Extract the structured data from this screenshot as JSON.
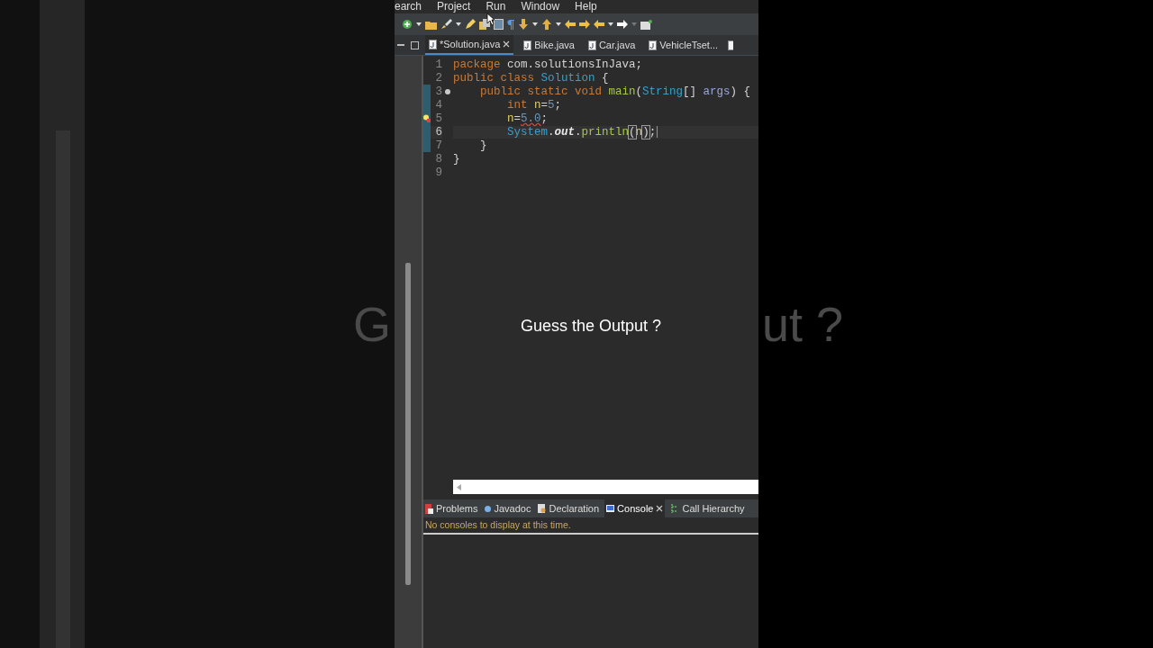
{
  "backdrop": {
    "left_text": "G",
    "right_text": "ut ?"
  },
  "menu": [
    "earch",
    "Project",
    "Run",
    "Window",
    "Help"
  ],
  "editor_tabs": [
    {
      "label": "*Solution.java",
      "selected": true,
      "closable": true
    },
    {
      "label": "Bike.java",
      "selected": false,
      "closable": false
    },
    {
      "label": "Car.java",
      "selected": false,
      "closable": false
    },
    {
      "label": "VehicleTset...",
      "selected": false,
      "closable": false
    }
  ],
  "code_lines": [
    {
      "number": "1",
      "range": false,
      "override": false,
      "error": false,
      "current": false,
      "tokens": [
        {
          "kind": "keyword",
          "text": "package"
        },
        {
          "kind": "plain",
          "text": " com.solutionsInJava;"
        }
      ]
    },
    {
      "number": "2",
      "range": false,
      "override": false,
      "error": false,
      "current": false,
      "tokens": [
        {
          "kind": "keyword",
          "text": "public class "
        },
        {
          "kind": "type",
          "text": "Solution"
        },
        {
          "kind": "plain",
          "text": " {"
        }
      ]
    },
    {
      "number": "3",
      "range": true,
      "override": true,
      "error": false,
      "current": false,
      "tokens": [
        {
          "kind": "keyword",
          "text": "    public static void "
        },
        {
          "kind": "method",
          "text": "main"
        },
        {
          "kind": "plain",
          "text": "("
        },
        {
          "kind": "type",
          "text": "String"
        },
        {
          "kind": "plain",
          "text": "[] "
        },
        {
          "kind": "param",
          "text": "args"
        },
        {
          "kind": "plain",
          "text": ") {"
        }
      ]
    },
    {
      "number": "4",
      "range": true,
      "override": false,
      "error": false,
      "current": false,
      "tokens": [
        {
          "kind": "keyword",
          "text": "        int "
        },
        {
          "kind": "variable",
          "text": "n"
        },
        {
          "kind": "plain",
          "text": "="
        },
        {
          "kind": "number",
          "text": "5"
        },
        {
          "kind": "plain",
          "text": ";"
        }
      ]
    },
    {
      "number": "5",
      "range": true,
      "override": false,
      "error": true,
      "current": false,
      "tokens": [
        {
          "kind": "variable",
          "text": "        n"
        },
        {
          "kind": "plain",
          "text": "="
        },
        {
          "kind": "number_error",
          "text": "5.0"
        },
        {
          "kind": "plain",
          "text": ";"
        }
      ]
    },
    {
      "number": "6",
      "range": true,
      "override": false,
      "error": false,
      "current": true,
      "tokens": [
        {
          "kind": "type",
          "text": "        System"
        },
        {
          "kind": "plain",
          "text": "."
        },
        {
          "kind": "field",
          "text": "out"
        },
        {
          "kind": "plain",
          "text": "."
        },
        {
          "kind": "method",
          "text": "println"
        },
        {
          "kind": "bracket",
          "text": "("
        },
        {
          "kind": "variable",
          "text": "n"
        },
        {
          "kind": "bracket",
          "text": ")"
        },
        {
          "kind": "plain",
          "text": ";"
        }
      ]
    },
    {
      "number": "7",
      "range": true,
      "override": false,
      "error": false,
      "current": false,
      "tokens": [
        {
          "kind": "plain",
          "text": "    }"
        }
      ]
    },
    {
      "number": "8",
      "range": false,
      "override": false,
      "error": false,
      "current": false,
      "tokens": [
        {
          "kind": "plain",
          "text": "}"
        }
      ]
    },
    {
      "number": "9",
      "range": false,
      "override": false,
      "error": false,
      "current": false
    }
  ],
  "overlay_caption": "Guess the Output ?",
  "bottom_tabs": [
    {
      "label": "Problems",
      "selected": false,
      "closable": false
    },
    {
      "label": "Javadoc",
      "selected": false,
      "closable": false
    },
    {
      "label": "Declaration",
      "selected": false,
      "closable": false
    },
    {
      "label": "Console",
      "selected": true,
      "closable": true
    },
    {
      "label": "Call Hierarchy",
      "selected": false,
      "closable": false
    }
  ],
  "console_message": "No consoles to display at this time."
}
